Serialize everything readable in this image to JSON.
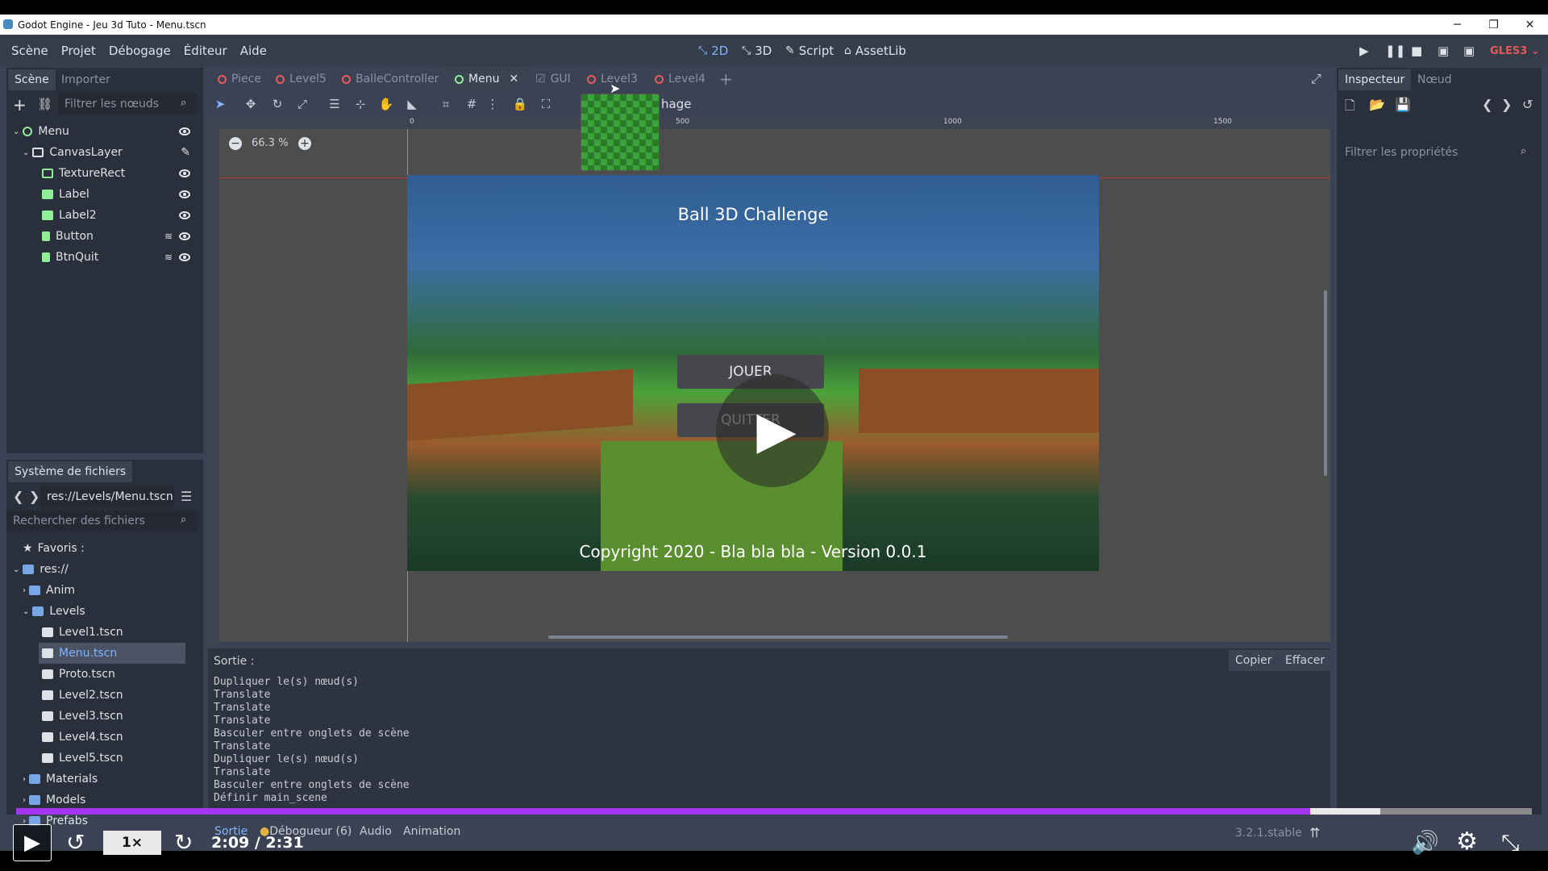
{
  "window": {
    "title": "Godot Engine - Jeu 3d Tuto - Menu.tscn"
  },
  "menubar": {
    "items": [
      "Scène",
      "Projet",
      "Débogage",
      "Éditeur",
      "Aide"
    ]
  },
  "modes": {
    "m2d": "2D",
    "m3d": "3D",
    "script": "Script",
    "assetlib": "AssetLib",
    "renderer": "GLES3"
  },
  "scene_dock": {
    "tabs": [
      "Scène",
      "Importer"
    ],
    "filter_placeholder": "Filtrer les nœuds",
    "nodes": [
      "Menu",
      "CanvasLayer",
      "TextureRect",
      "Label",
      "Label2",
      "Button",
      "BtnQuit"
    ]
  },
  "fs_dock": {
    "title": "Système de fichiers",
    "path": "res://Levels/Menu.tscn",
    "search_placeholder": "Rechercher des fichiers",
    "items": [
      "Favoris :",
      "res://",
      "Anim",
      "Levels",
      "Level1.tscn",
      "Menu.tscn",
      "Proto.tscn",
      "Level2.tscn",
      "Level3.tscn",
      "Level4.tscn",
      "Level5.tscn",
      "Materials",
      "Models",
      "Prefabs"
    ]
  },
  "scene_tabs": [
    "Piece",
    "Level5",
    "BalleController",
    "Menu",
    "GUI",
    "Level3",
    "Level4"
  ],
  "viewport": {
    "zoom": "66.3 %",
    "ruler": [
      "0",
      "500",
      "1000",
      "1500"
    ],
    "toolbar_partial": "hage",
    "game_title": "Ball 3D Challenge",
    "btn_play": "JOUER",
    "btn_quit": "QUITTER",
    "copyright": "Copyright 2020 - Bla bla bla - Version 0.0.1"
  },
  "inspector": {
    "tabs": [
      "Inspecteur",
      "Nœud"
    ],
    "filter_placeholder": "Filtrer les propriétés"
  },
  "output": {
    "label": "Sortie :",
    "copy": "Copier",
    "clear": "Effacer",
    "lines": [
      "Dupliquer le(s) nœud(s)",
      "Translate",
      "Translate",
      "Translate",
      "Basculer entre onglets de scène",
      "Translate",
      "Dupliquer le(s) nœud(s)",
      "Translate",
      "Basculer entre onglets de scène",
      "Définir main_scene"
    ]
  },
  "bottom_tabs": [
    "Sortie",
    "Débogueur (6)",
    "Audio",
    "Animation"
  ],
  "version": "3.2.1.stable",
  "player": {
    "speed": "1×",
    "time": "2:09 / 2:31",
    "progress": 0.854,
    "buffered": 0.9
  }
}
